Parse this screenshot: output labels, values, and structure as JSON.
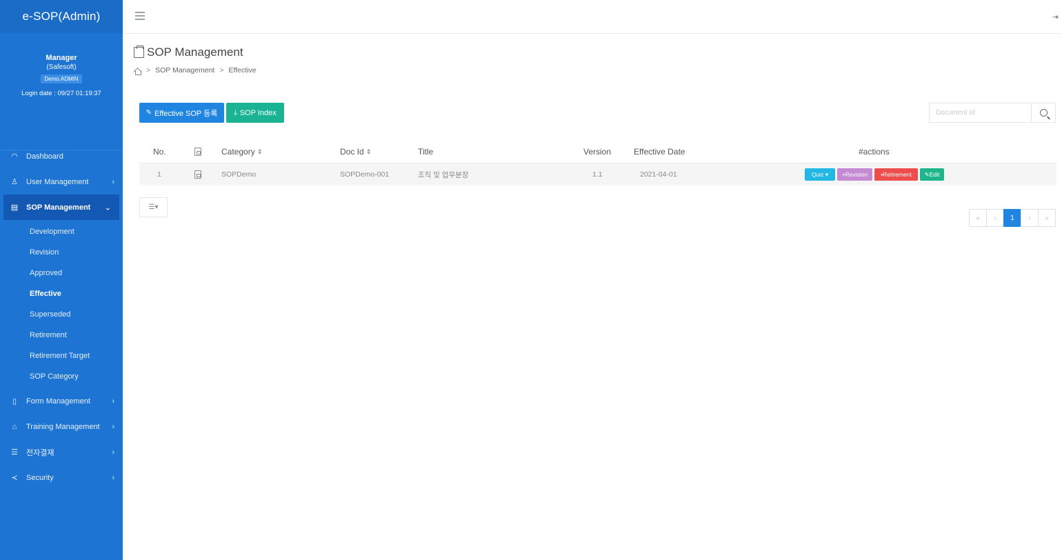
{
  "sidebar": {
    "brand": "e-SOP(Admin)",
    "user_name": "Manager",
    "company": "(Safesoft)",
    "role": "Demo.ADMIN",
    "login_date": "Login date : 09/27 01:19:37",
    "menu": {
      "dashboard": "Dashboard",
      "user_management": "User Management",
      "sop_management": "SOP Management",
      "form_management": "Form Management",
      "training_management": "Training Management",
      "approval": "전자결재",
      "security": "Security"
    },
    "sop_sub": {
      "development": "Development",
      "revision": "Revision",
      "approved": "Approved",
      "effective": "Effective",
      "superseded": "Superseded",
      "retirement": "Retirement",
      "retirement_target": "Retirement Target",
      "sop_category": "SOP Category"
    },
    "colors": {
      "background": "#1e74d3",
      "active": "#1359b3"
    }
  },
  "page": {
    "title": "SOP Management",
    "breadcrumb": [
      "SOP Management",
      "Effective"
    ]
  },
  "toolbar": {
    "register_label": "Effective SOP 등록",
    "index_label": "SOP Index",
    "search_placeholder": "Document Id"
  },
  "table": {
    "headers": {
      "no": "No.",
      "category": "Category",
      "doc_id": "Doc Id",
      "title": "Title",
      "version": "Version",
      "effective_date": "Effective Date",
      "actions": "#actions"
    },
    "rows": [
      {
        "no": "1",
        "category": "SOPDemo",
        "doc_id": "SOPDemo-001",
        "title": "조직 및 업무분장",
        "version": "1.1",
        "effective_date": "2021-04-01"
      }
    ],
    "actions": {
      "quiz": "Quiz ▾",
      "revision": "Revision",
      "retirement": "Retirement",
      "edit": "Edit"
    }
  },
  "pagination": {
    "current": "1"
  }
}
